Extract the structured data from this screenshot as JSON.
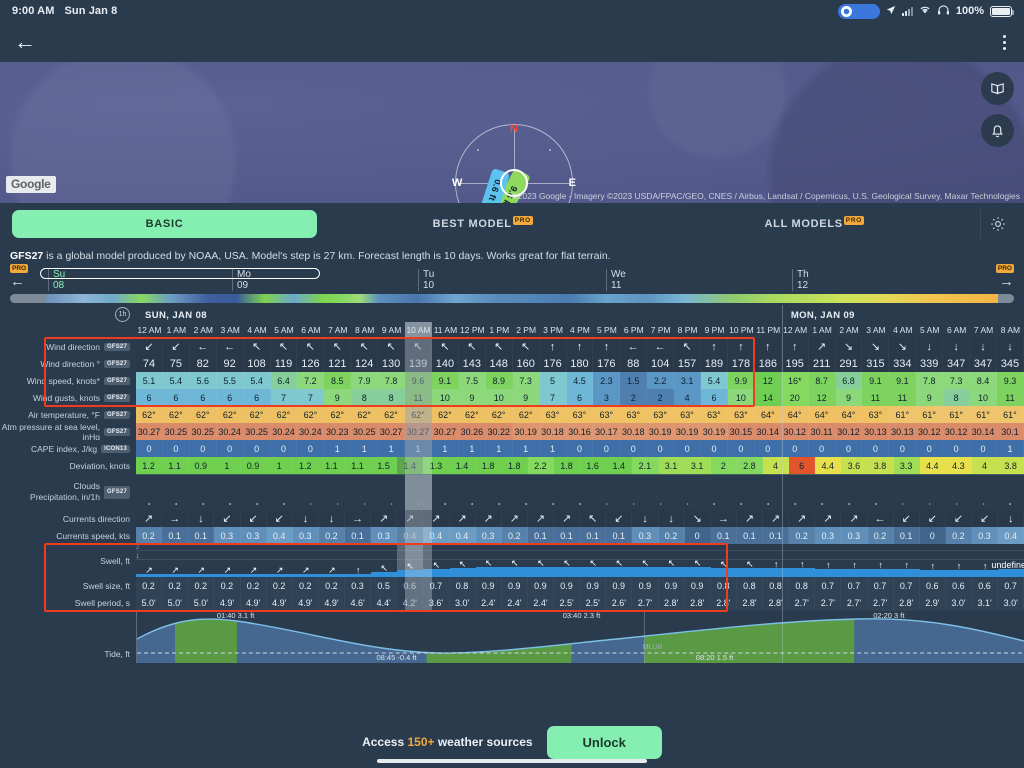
{
  "status_bar": {
    "time": "9:00 AM",
    "date": "Sun Jan 8",
    "battery_pct": "100%"
  },
  "nav": {
    "back_icon": "arrow-left-icon",
    "menu_icon": "more-vertical-icon"
  },
  "map": {
    "google_logo": "Google",
    "attribution": "©2023 Google - Imagery ©2023 USDA/FPAC/GEO, CNES / Airbus, Landsat / Copernicus, U.S. Geological Survey, Maxar Technologies",
    "compass": {
      "north": "N",
      "south": "S",
      "east": "E",
      "west": "W",
      "wind_label": "9.6 kts",
      "swell_label": "0.6 ft 4.2s",
      "wind_color": "#8fd95f",
      "swell_color": "#5cc3f0"
    },
    "buttons": [
      {
        "name": "map-layers-icon"
      },
      {
        "name": "alerts-bell-icon"
      }
    ]
  },
  "tabs": [
    {
      "label": "BASIC",
      "pro": false,
      "active": true
    },
    {
      "label": "BEST MODEL",
      "pro": true,
      "active": false
    },
    {
      "label": "ALL MODELS",
      "pro": true,
      "active": false
    }
  ],
  "pro_badge": "PRO",
  "settings_icon": "gear-icon",
  "model_desc": {
    "model": "GFS27",
    "text": " is a global model produced by NOAA, USA. Model's step is 27 km. Forecast length is 10 days. Works great for flat terrain."
  },
  "scrubber": {
    "days": [
      {
        "dow": "Su",
        "dom": "08",
        "current": true
      },
      {
        "dow": "Mo",
        "dom": "09",
        "current": false
      },
      {
        "dow": "Tu",
        "dom": "10",
        "current": false
      },
      {
        "dow": "We",
        "dom": "11",
        "current": false
      },
      {
        "dow": "Th",
        "dom": "12",
        "current": false
      }
    ],
    "left_arrow": "←",
    "right_arrow": "→"
  },
  "table": {
    "interval": "1h",
    "day_headers": [
      "SUN, JAN 08",
      "MON, JAN 09"
    ],
    "hours": [
      "12 AM",
      "1 AM",
      "2 AM",
      "3 AM",
      "4 AM",
      "5 AM",
      "6 AM",
      "7 AM",
      "8 AM",
      "9 AM",
      "10 AM",
      "11 AM",
      "12 PM",
      "1 PM",
      "2 PM",
      "3 PM",
      "4 PM",
      "5 PM",
      "6 PM",
      "7 PM",
      "8 PM",
      "9 PM",
      "10 PM",
      "11 PM",
      "12 AM",
      "1 AM",
      "2 AM",
      "3 AM",
      "4 AM",
      "5 AM",
      "6 AM",
      "7 AM",
      "8 AM"
    ],
    "now_index": 10,
    "rows": [
      {
        "label": "Wind direction",
        "badge": "GFS27",
        "values": [
          "↙",
          "↙",
          "←",
          "←",
          "↖",
          "↖",
          "↖",
          "↖",
          "↖",
          "↖",
          "↖",
          "↖",
          "↖",
          "↖",
          "↖",
          "↑",
          "↑",
          "↑",
          "←",
          "←",
          "↖",
          "↑",
          "↑",
          "↑",
          "↑",
          "↗",
          "↘",
          "↘",
          "↘",
          "↓",
          "↓",
          "↓",
          "↓"
        ]
      },
      {
        "label": "Wind direction °",
        "badge": "GFS27",
        "values": [
          "74",
          "75",
          "82",
          "92",
          "108",
          "119",
          "126",
          "121",
          "124",
          "130",
          "139",
          "140",
          "143",
          "148",
          "160",
          "176",
          "180",
          "176",
          "88",
          "104",
          "157",
          "189",
          "178",
          "186",
          "195",
          "211",
          "291",
          "315",
          "334",
          "339",
          "347",
          "347",
          "345"
        ]
      },
      {
        "label": "Wind speed, knots*",
        "badge": "GFS27",
        "values": [
          "5.1",
          "5.4",
          "5.6",
          "5.5",
          "5.4",
          "6.4",
          "7.2",
          "8.5",
          "7.9",
          "7.8",
          "9.6",
          "9.1",
          "7.5",
          "8.9",
          "7.3",
          "5",
          "4.5",
          "2.3",
          "1.5",
          "2.2",
          "3.1",
          "5.4",
          "9.9",
          "12",
          "16*",
          "8.7",
          "6.8",
          "9.1",
          "9.1",
          "7.8",
          "7.3",
          "8.4",
          "9.3"
        ]
      },
      {
        "label": "Wind gusts, knots",
        "badge": "GFS27",
        "values": [
          "6",
          "6",
          "6",
          "6",
          "6",
          "7",
          "7",
          "9",
          "8",
          "8",
          "11",
          "10",
          "9",
          "10",
          "9",
          "7",
          "6",
          "3",
          "2",
          "2",
          "4",
          "6",
          "10",
          "14",
          "20",
          "12",
          "9",
          "11",
          "11",
          "9",
          "8",
          "10",
          "11"
        ]
      },
      {
        "label": "Air temperature, °F",
        "badge": "GFS27",
        "values": [
          "62°",
          "62°",
          "62°",
          "62°",
          "62°",
          "62°",
          "62°",
          "62°",
          "62°",
          "62°",
          "62°",
          "62°",
          "62°",
          "62°",
          "62°",
          "63°",
          "63°",
          "63°",
          "63°",
          "63°",
          "63°",
          "63°",
          "63°",
          "64°",
          "64°",
          "64°",
          "64°",
          "63°",
          "61°",
          "61°",
          "61°",
          "61°",
          "61°"
        ]
      },
      {
        "label": "Atm pressure at sea level, inHg",
        "badge": "GFS27",
        "values": [
          "30.27",
          "30.25",
          "30.25",
          "30.24",
          "30.25",
          "30.24",
          "30.24",
          "30.23",
          "30.25",
          "30.27",
          "30.27",
          "30.27",
          "30.26",
          "30.22",
          "30.19",
          "30.18",
          "30.16",
          "30.17",
          "30.18",
          "30.19",
          "30.19",
          "30.19",
          "30.15",
          "30.14",
          "30.12",
          "30.11",
          "30.12",
          "30.13",
          "30.13",
          "30.12",
          "30.12",
          "30.14",
          "30.1"
        ]
      },
      {
        "label": "CAPE index, J/kg",
        "badge": "ICON13",
        "values": [
          "0",
          "0",
          "0",
          "0",
          "0",
          "0",
          "0",
          "1",
          "1",
          "1",
          "1",
          "1",
          "1",
          "1",
          "1",
          "1",
          "0",
          "0",
          "0",
          "0",
          "0",
          "0",
          "0",
          "0",
          "0",
          "0",
          "0",
          "0",
          "0",
          "0",
          "0",
          "0",
          "1"
        ]
      },
      {
        "label": "Deviation, knots",
        "badge": "",
        "values": [
          "1.2",
          "1.1",
          "0.9",
          "1",
          "0.9",
          "1",
          "1.2",
          "1.1",
          "1.1",
          "1.5",
          "1.4",
          "1.3",
          "1.4",
          "1.8",
          "1.8",
          "2.2",
          "1.8",
          "1.6",
          "1.4",
          "2.1",
          "3.1",
          "3.1",
          "2",
          "2.8",
          "4",
          "6",
          "4.4",
          "3.6",
          "3.8",
          "3.3",
          "4.4",
          "4.3",
          "4",
          "3.8"
        ]
      },
      {
        "label": "Currents direction",
        "badge": "",
        "values": [
          "↗",
          "→",
          "↓",
          "↙",
          "↙",
          "↙",
          "↓",
          "↓",
          "→",
          "↗",
          "↗",
          "↗",
          "↗",
          "↗",
          "↗",
          "↗",
          "↗",
          "↖",
          "↙",
          "↓",
          "↓",
          "↘",
          "→",
          "↗",
          "↗",
          "↗",
          "↗",
          "↗",
          "←",
          "↙",
          "↙",
          "↙",
          "↙",
          "↓"
        ]
      },
      {
        "label": "Currents speed, kts",
        "badge": "",
        "values": [
          "0.2",
          "0.1",
          "0.1",
          "0.3",
          "0.3",
          "0.4",
          "0.3",
          "0.2",
          "0.1",
          "0.3",
          "0.4",
          "0.4",
          "0.4",
          "0.3",
          "0.2",
          "0.1",
          "0.1",
          "0.1",
          "0.1",
          "0.3",
          "0.2",
          "0",
          "0.1",
          "0.1",
          "0.1",
          "0.2",
          "0.3",
          "0.3",
          "0.2",
          "0.1",
          "0",
          "0.2",
          "0.3",
          "0.4"
        ]
      },
      {
        "label": "Swell size, ft",
        "badge": "",
        "values": [
          "0.2",
          "0.2",
          "0.2",
          "0.2",
          "0.2",
          "0.2",
          "0.2",
          "0.2",
          "0.3",
          "0.5",
          "0.6",
          "0.7",
          "0.8",
          "0.9",
          "0.9",
          "0.9",
          "0.9",
          "0.9",
          "0.9",
          "0.9",
          "0.9",
          "0.9",
          "0.8",
          "0.8",
          "0.8",
          "0.8",
          "0.7",
          "0.7",
          "0.7",
          "0.7",
          "0.6",
          "0.6",
          "0.6",
          "0.7"
        ]
      },
      {
        "label": "Swell period, s",
        "badge": "",
        "values": [
          "5.0'",
          "5.0'",
          "5.0'",
          "4.9'",
          "4.9'",
          "4.9'",
          "4.9'",
          "4.9'",
          "4.6'",
          "4.4'",
          "4.2'",
          "3.6'",
          "3.0'",
          "2.4'",
          "2.4'",
          "2.4'",
          "2.5'",
          "2.5'",
          "2.6'",
          "2.7'",
          "2.8'",
          "2.8'",
          "2.8'",
          "2.8'",
          "2.8'",
          "2.7'",
          "2.7'",
          "2.7'",
          "2.7'",
          "2.8'",
          "2.9'",
          "3.0'",
          "3.1'",
          "3.0'"
        ]
      }
    ],
    "swell_chart": {
      "label": "Swell, ft",
      "axis": [
        "2",
        "1"
      ],
      "arrows": [
        "↗",
        "↗",
        "↗",
        "↗",
        "↗",
        "↗",
        "↗",
        "↗",
        "↑",
        "↖",
        "↖",
        "↖",
        "↖",
        "↖",
        "↖",
        "↖",
        "↖",
        "↖",
        "↖",
        "↖",
        "↖",
        "↖",
        "↖",
        "↖",
        "↑",
        "↑",
        "↑",
        "↑",
        "↑",
        "↑",
        "↑",
        "↑",
        "↑"
      ]
    },
    "clouds_row": {
      "label_line1": "Clouds",
      "label_line2": "Precipitation, in/1h",
      "badge": "GFS27"
    }
  },
  "tide": {
    "label": "Tide, ft",
    "markers": [
      {
        "text": "01:40 3.1 ft",
        "x_pct": 9,
        "top": true
      },
      {
        "text": "08:45 -0.4 ft",
        "x_pct": 27,
        "top": false
      },
      {
        "text": "03:40 2.3 ft",
        "x_pct": 48,
        "top": true
      },
      {
        "text": "08:20 1.5 ft",
        "x_pct": 63,
        "top": false
      },
      {
        "text": "02:20 3 ft",
        "x_pct": 83,
        "top": true
      }
    ],
    "datum_label": "MLLW"
  },
  "bottom": {
    "text_prefix": "Access ",
    "highlight": "150+",
    "text_suffix": " weather sources",
    "unlock_label": "Unlock"
  }
}
